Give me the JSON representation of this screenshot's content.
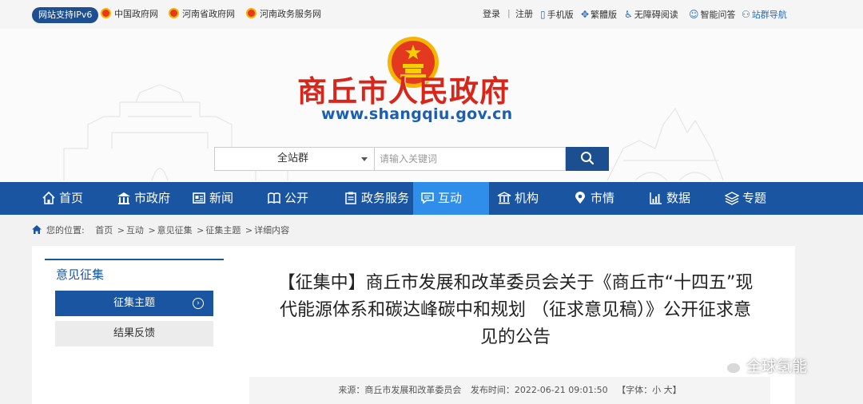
{
  "topbar": {
    "ipv6_badge": "网站支持IPv6",
    "gov_links": [
      "中国政府网",
      "河南省政府网",
      "河南政务服务网"
    ],
    "right_links": [
      "登录",
      "注册",
      "手机版",
      "繁體版",
      "无障碍阅读",
      "智能问答",
      "站群导航"
    ]
  },
  "header": {
    "site_title": "商丘市人民政府",
    "site_url": "www.shangqiu.gov.cn",
    "search": {
      "scope": "全站群",
      "placeholder": "请输入关键词"
    }
  },
  "nav": {
    "items": [
      "首页",
      "市政府",
      "新闻",
      "公开",
      "政务服务",
      "互动",
      "机构",
      "市情",
      "数据",
      "专题"
    ],
    "active": "互动"
  },
  "breadcrumb": {
    "prefix": "您的位置:",
    "path": [
      "首页",
      "互动",
      "意见征集",
      "征集主题",
      "详细内容"
    ],
    "sep": ">"
  },
  "sidebar": {
    "title": "意见征集",
    "items": [
      "征集主题",
      "结果反馈"
    ]
  },
  "article": {
    "title": "【征集中】商丘市发展和改革委员会关于《商丘市“十四五”现代能源体系和碳达峰碳中和规划 （征求意见稿）》公开征求意见的公告",
    "source": "来源：商丘市发展和改革委员会",
    "published": "发布时间：2022-06-21 09:01:50",
    "font_size_label": "【字体：小 大】"
  },
  "watermark": "全球氢能",
  "colors": {
    "nav_bg": "#1a55a1",
    "nav_active": "#2e8ee9",
    "title_red": "#d8261b",
    "url_blue": "#1b5fb4",
    "ipv6_bg": "#1d4f91"
  }
}
